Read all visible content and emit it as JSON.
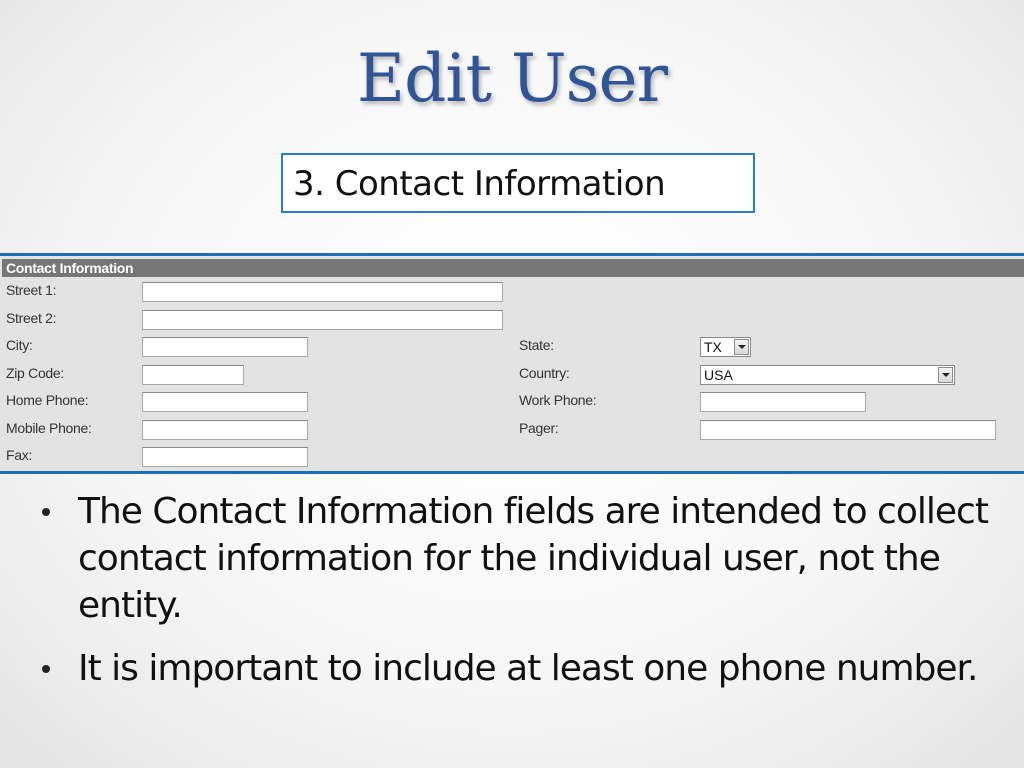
{
  "slide": {
    "title": "Edit User",
    "subtitle": "3. Contact Information"
  },
  "form": {
    "header": "Contact Information",
    "fields": {
      "street1": {
        "label": "Street 1:",
        "value": ""
      },
      "street2": {
        "label": "Street 2:",
        "value": ""
      },
      "city": {
        "label": "City:",
        "value": ""
      },
      "zip": {
        "label": "Zip Code:",
        "value": ""
      },
      "home_phone": {
        "label": "Home Phone:",
        "value": ""
      },
      "mobile_phone": {
        "label": "Mobile Phone:",
        "value": ""
      },
      "fax": {
        "label": "Fax:",
        "value": ""
      },
      "state": {
        "label": "State:",
        "value": "TX"
      },
      "country": {
        "label": "Country:",
        "value": "USA"
      },
      "work_phone": {
        "label": "Work Phone:",
        "value": ""
      },
      "pager": {
        "label": "Pager:",
        "value": ""
      }
    }
  },
  "bullets": [
    "The Contact Information fields are intended to collect contact information for the individual user, not the entity.",
    "It is important to include at least one phone number."
  ],
  "colors": {
    "title": "#2f5597",
    "accent_border": "#1e6db5",
    "panel_header": "#767676",
    "panel_bg": "#e3e3e3"
  }
}
